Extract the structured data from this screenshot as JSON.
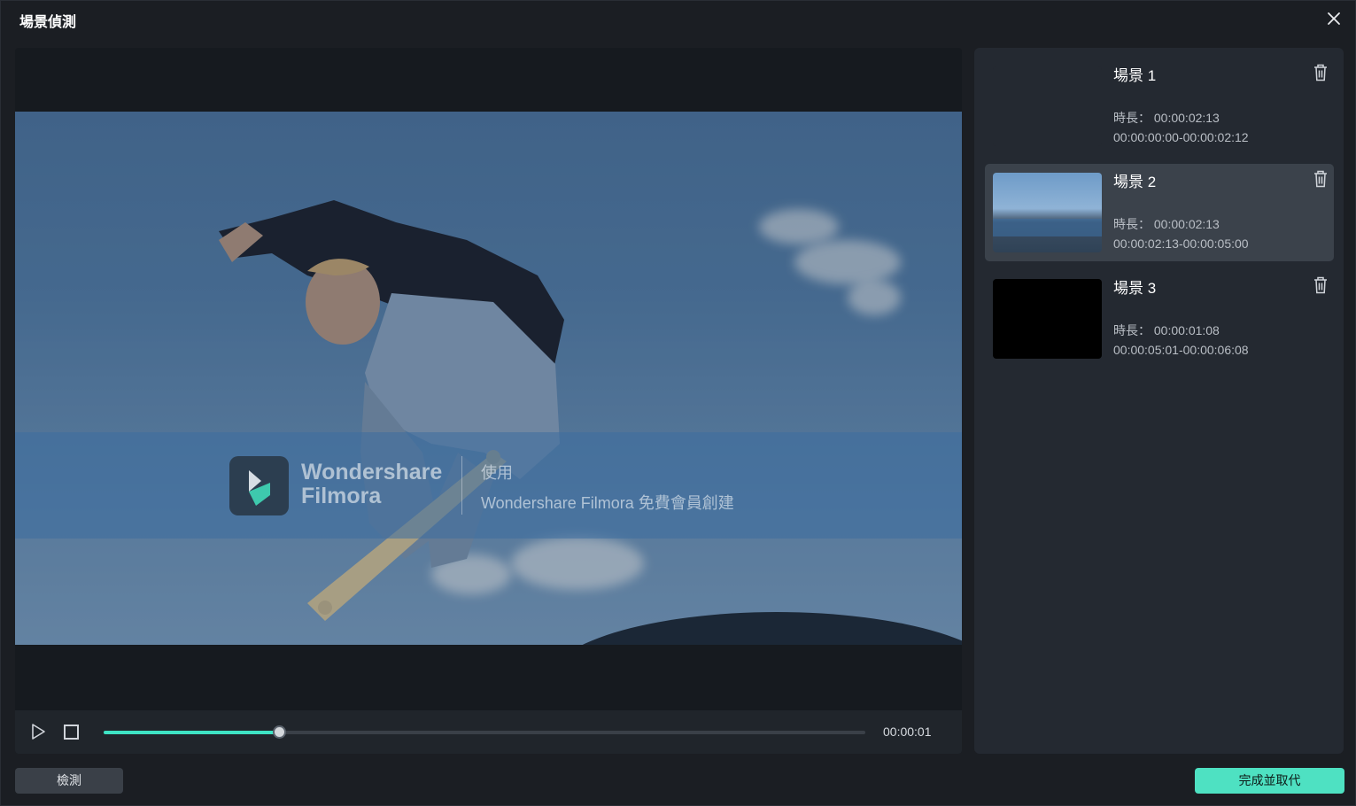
{
  "dialog": {
    "title": "場景偵測"
  },
  "preview": {
    "watermark": {
      "brand_line1": "Wondershare",
      "brand_line2": "Filmora",
      "text_line1": "使用",
      "text_line2": "Wondershare Filmora 免費會員創建"
    },
    "controls": {
      "time": "00:00:01",
      "progress": 0.23
    }
  },
  "scenes": [
    {
      "title": "場景 1",
      "duration": "時長： 00:00:02:13",
      "range": "00:00:00:00-00:00:02:12",
      "selected": false
    },
    {
      "title": "場景 2",
      "duration": "時長： 00:00:02:13",
      "range": "00:00:02:13-00:00:05:00",
      "selected": true
    },
    {
      "title": "場景 3",
      "duration": "時長： 00:00:01:08",
      "range": "00:00:05:01-00:00:06:08",
      "selected": false
    }
  ],
  "buttons": {
    "detect": "檢測",
    "finish": "完成並取代"
  },
  "colors": {
    "accent": "#4ee1c2",
    "background": "#1b1e23",
    "panel": "#242931",
    "selected_scene": "#3b424b"
  }
}
